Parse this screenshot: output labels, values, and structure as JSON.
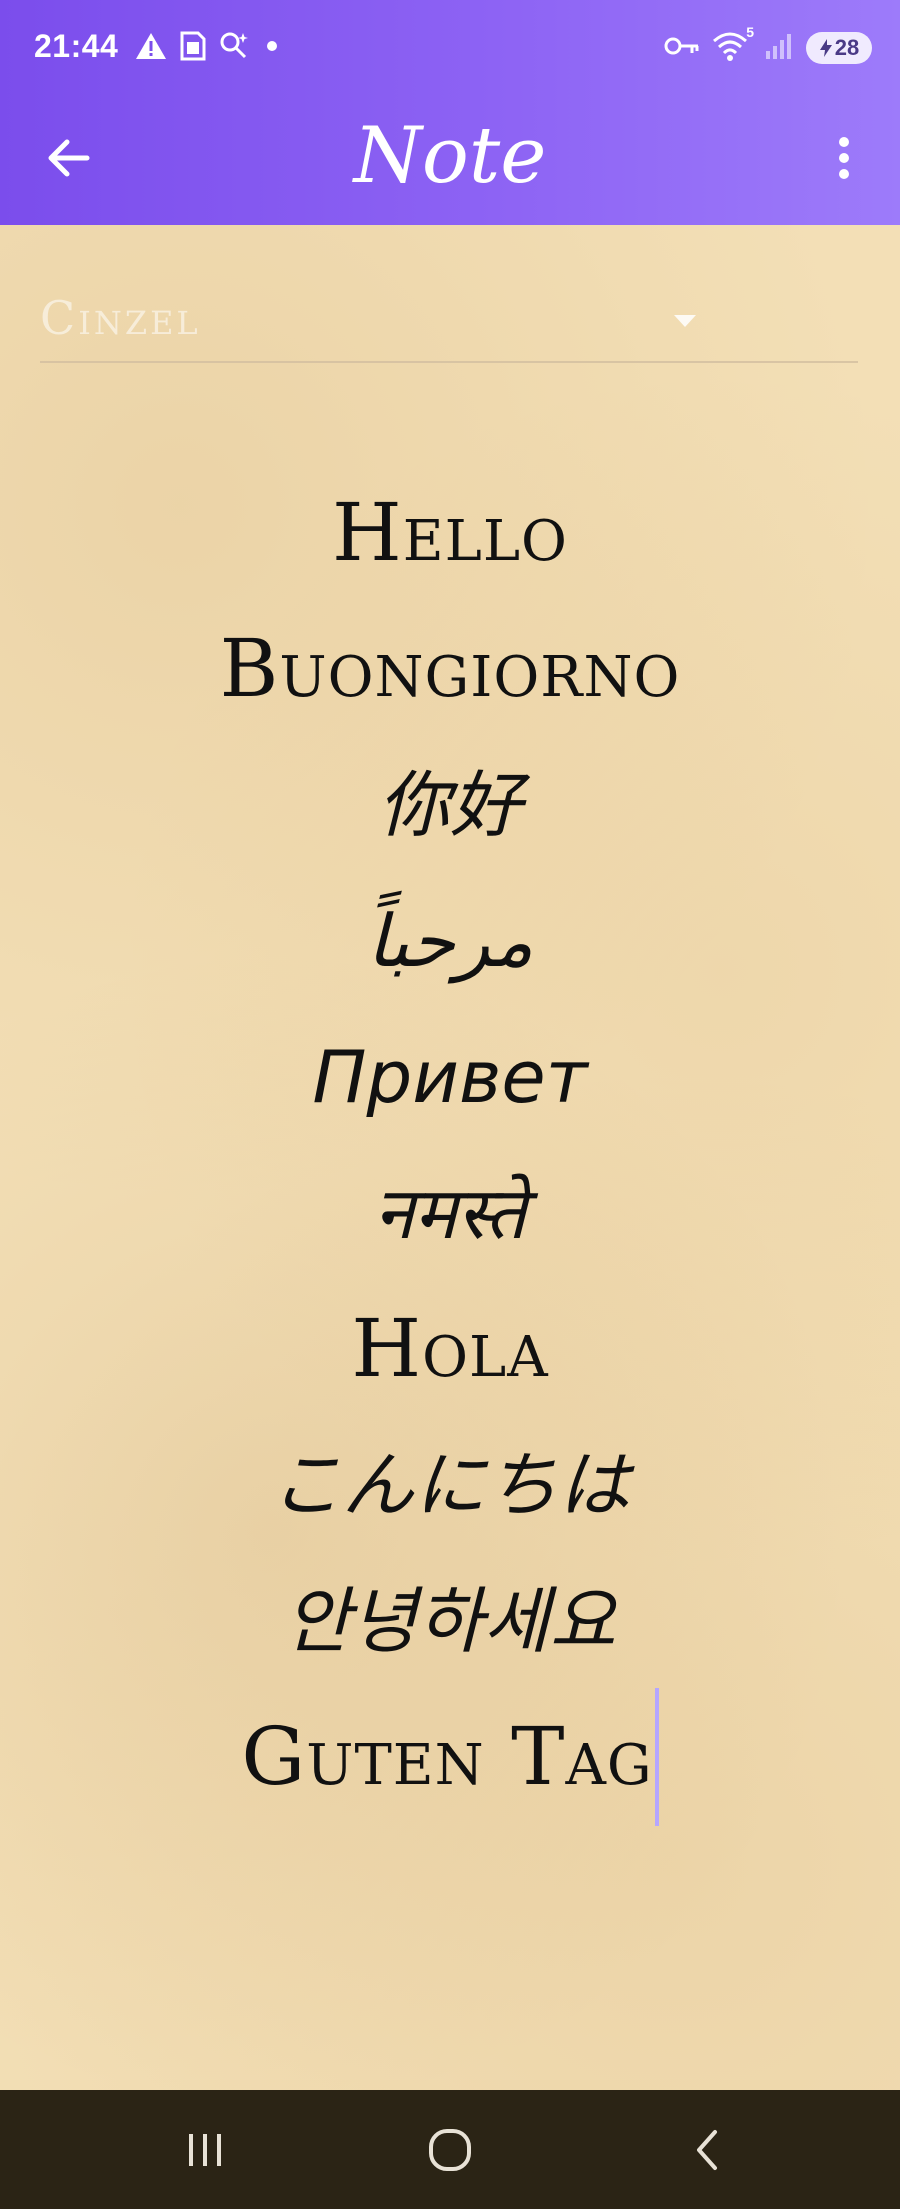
{
  "status_bar": {
    "time": "21:44",
    "battery_level": "28",
    "wifi_badge": "5",
    "icons_left": [
      "warning-icon",
      "sim-card-icon",
      "search-sparkle-icon",
      "dot-icon"
    ],
    "icons_right": [
      "vpn-key-icon",
      "wifi-icon",
      "signal-icon",
      "battery-icon"
    ]
  },
  "app_bar": {
    "title": "Note",
    "back_icon": "arrow-left-icon",
    "menu_icon": "more-vertical-icon"
  },
  "editor": {
    "font_selector": {
      "selected": "Cinzel"
    },
    "lines": [
      "Hello",
      "Buongiorno",
      "你好",
      "مرحباً",
      "Привет",
      "नमस्ते",
      "Hola",
      "こんにちは",
      "안녕하세요",
      "Guten Tag"
    ]
  },
  "nav_bar": {
    "icons": [
      "recent-apps-icon",
      "home-icon",
      "back-icon"
    ]
  },
  "colors": {
    "header_start": "#7b4dec",
    "header_end": "#9d7bfa",
    "parchment": "#f3dfb6",
    "nav_bar": "#2b2415",
    "cursor": "#b5a6ff"
  }
}
